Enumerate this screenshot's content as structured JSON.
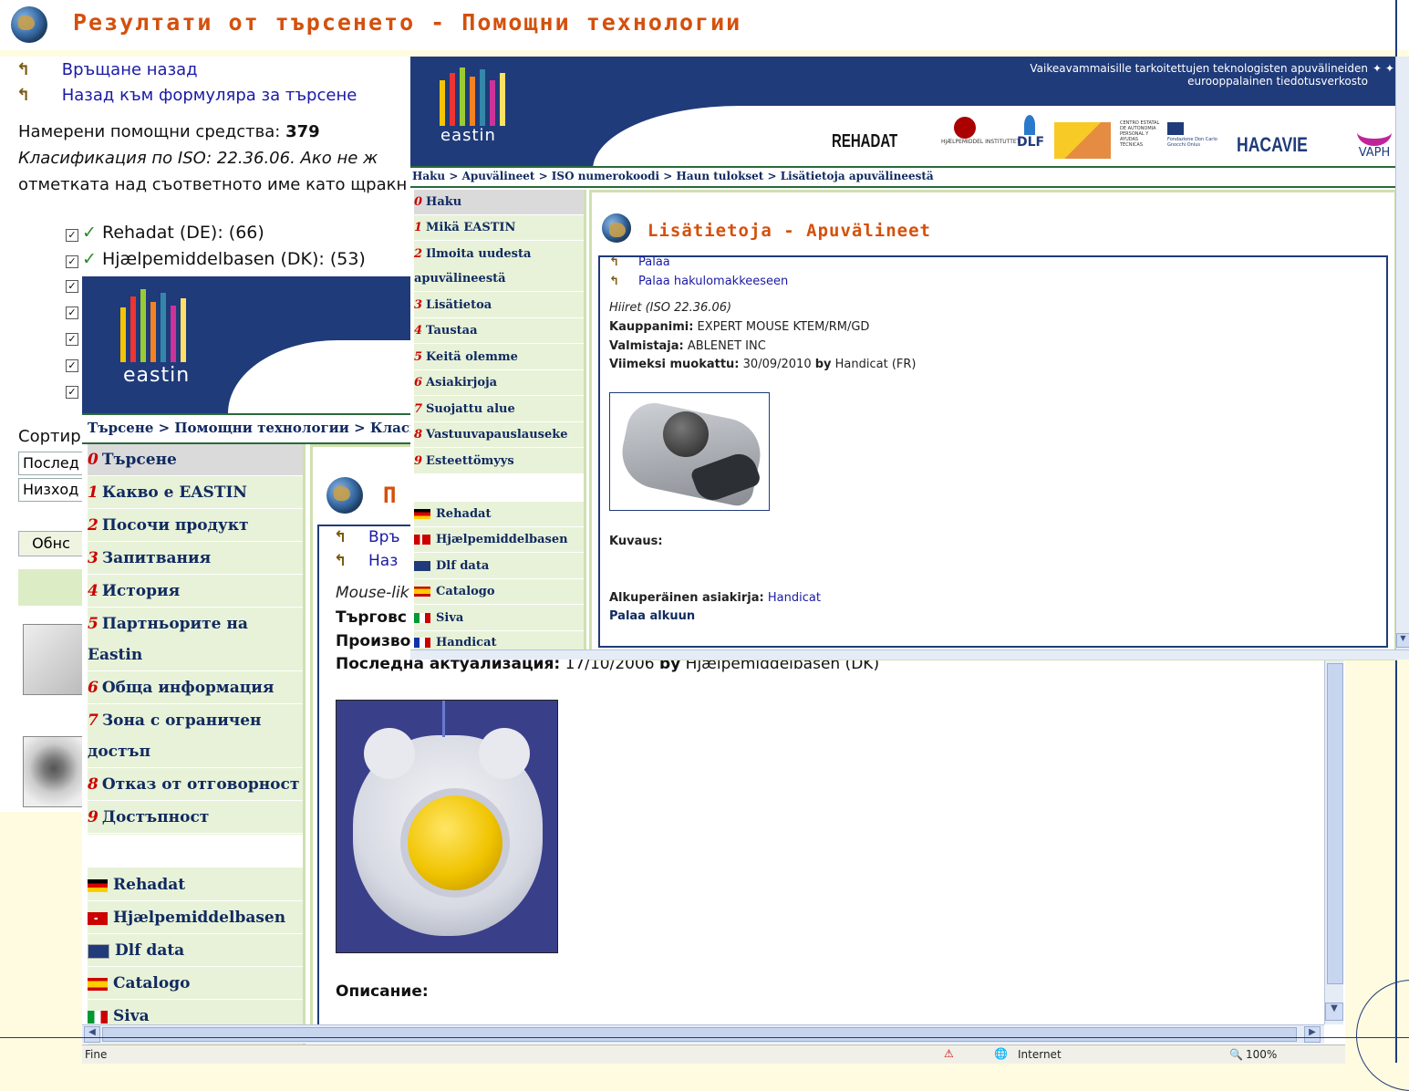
{
  "slide": {
    "title": "Резултати от търсенето - Помощни технологии"
  },
  "bg_page": {
    "links": [
      "Връщане назад",
      "Назад към формуляра за търсене"
    ],
    "found_label": "Намерени помощни средства:",
    "found_count": "379",
    "iso_line": "Класификация по ISO: 22.36.06. Ако не ж",
    "checkbox_line": "отметката над съответното име като щракн",
    "providers": [
      "Rehadat (DE): (66)",
      "Hjælpemiddelbasen (DK): (53)"
    ],
    "sort_label": "Сортир",
    "sort_options": [
      "Послед",
      "Низход"
    ],
    "update_button": "Обнс"
  },
  "bg_window": {
    "logo_text": "eastin",
    "breadcrumb": "Търсене > Помощни технологии > Класи",
    "nav_items": [
      {
        "n": "0",
        "label": "Търсене"
      },
      {
        "n": "1",
        "label": "Какво е EASTIN"
      },
      {
        "n": "2",
        "label": "Посочи продукт"
      },
      {
        "n": "3",
        "label": "Запитвания"
      },
      {
        "n": "4",
        "label": "История"
      },
      {
        "n": "5",
        "label": "Партньорите на"
      },
      {
        "n": "",
        "label": "Eastin"
      },
      {
        "n": "6",
        "label": "Обща информация"
      },
      {
        "n": "7",
        "label": "Зона с ограничен"
      },
      {
        "n": "",
        "label": "достъп"
      },
      {
        "n": "8",
        "label": "Отказ от отговорност"
      },
      {
        "n": "9",
        "label": "Достъпност"
      }
    ],
    "db_items": [
      "Rehadat",
      "Hjælpemiddelbasen",
      "Dlf data",
      "Catalogo",
      "Siva"
    ],
    "heading_fragment": "П",
    "links": [
      "Връ",
      "Наз"
    ],
    "mouse_line": "Mouse-lik",
    "trade_label": "Търговс",
    "maker_label": "Произво",
    "updated_label": "Последна актуализация:",
    "updated_value": "17/10/2006",
    "by_label": "by",
    "updated_source": "Hjælpemiddelbasen (DK)",
    "description_label": "Описание:",
    "status_left": "Fine",
    "status_zone": "Internet",
    "status_zoom": "100%"
  },
  "fg_window": {
    "tagline_1": "Vaikeavammaisille tarkoitettujen teknologisten apuvälineiden",
    "tagline_2": "eurooppalainen tiedotusverkosto",
    "logo_text": "eastin",
    "partners": [
      "REHADAT",
      "HJÆLPEMIDDEL INSTITUTTET",
      "DLF",
      "CENTRO ESTATAL DE AUTONOMIA PERSONAL Y AYUDAS TÉCNICAS",
      "Fondazione Don Carlo Gnocchi Onlus",
      "HACAVIE",
      "VAPH"
    ],
    "breadcrumb": "Haku > Apuvälineet > ISO numerokoodi > Haun tulokset > Lisätietoja apuvälineestä",
    "nav_items": [
      {
        "n": "0",
        "label": "Haku"
      },
      {
        "n": "1",
        "label": "Mikä EASTIN"
      },
      {
        "n": "2",
        "label": "Ilmoita uudesta"
      },
      {
        "n": "",
        "label": "apuvälineestä"
      },
      {
        "n": "3",
        "label": "Lisätietoa"
      },
      {
        "n": "4",
        "label": "Taustaa"
      },
      {
        "n": "5",
        "label": "Keitä olemme"
      },
      {
        "n": "6",
        "label": "Asiakirjoja"
      },
      {
        "n": "7",
        "label": "Suojattu alue"
      },
      {
        "n": "8",
        "label": "Vastuuvapauslauseke"
      },
      {
        "n": "9",
        "label": "Esteettömyys"
      }
    ],
    "db_items": [
      "Rehadat",
      "Hjælpemiddelbasen",
      "Dlf data",
      "Catalogo",
      "Siva",
      "Handicat"
    ],
    "heading": "Lisätietoja - Apuvälineet",
    "links": [
      "Palaa",
      "Palaa hakulomakkeeseen"
    ],
    "category": "Hiiret (ISO 22.36.06)",
    "trade_label": "Kauppanimi:",
    "trade_value": "EXPERT MOUSE KTEM/RM/GD",
    "maker_label": "Valmistaja:",
    "maker_value": "ABLENET INC",
    "updated_label": "Viimeksi muokattu:",
    "updated_value": "30/09/2010",
    "by_label": "by",
    "updated_source": "Handicat (FR)",
    "desc_label": "Kuvaus:",
    "orig_label": "Alkuperäinen asiakirja:",
    "orig_value": "Handicat",
    "top_link": "Palaa alkuun"
  },
  "colors": {
    "title_orange": "#d4500c",
    "eastin_blue": "#1f3b7a",
    "nav_green": "#e8f2d8",
    "link_blue": "#1a1aa6"
  }
}
